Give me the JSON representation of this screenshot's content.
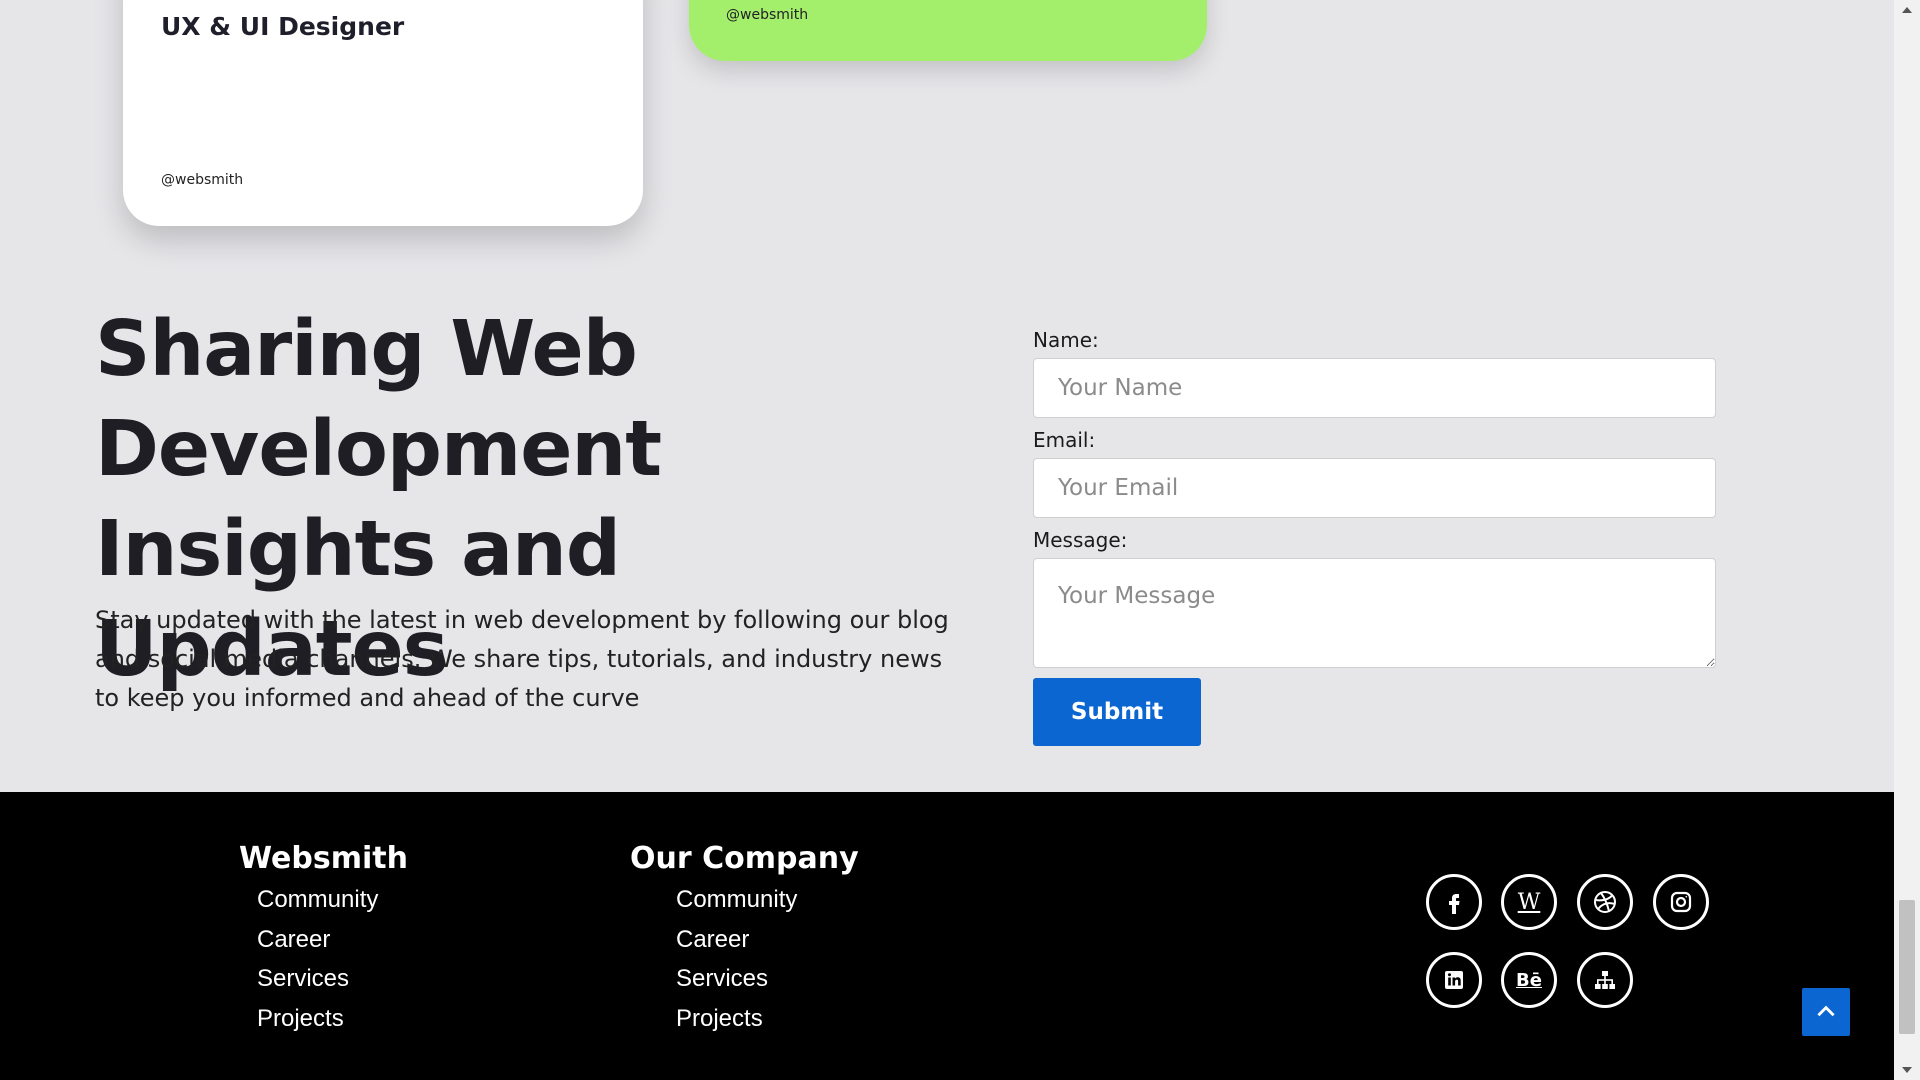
{
  "cards": {
    "designer": {
      "role": "UX & UI Designer",
      "handle": "@websmith"
    },
    "green": {
      "handle": "@websmith"
    }
  },
  "insights": {
    "title": "Sharing Web Development Insights and Updates",
    "text": "Stay updated with the latest in web development by following our blog and social media channels. We share tips, tutorials, and industry news to keep you informed and ahead of the curve"
  },
  "form": {
    "name_label": "Name:",
    "name_placeholder": "Your Name",
    "email_label": "Email:",
    "email_placeholder": "Your Email",
    "message_label": "Message:",
    "message_placeholder": "Your Message",
    "submit_label": "Submit"
  },
  "footer": {
    "col1": {
      "title": "Websmith",
      "links": [
        "Community",
        "Career",
        "Services",
        "Projects"
      ]
    },
    "col2": {
      "title": "Our Company",
      "links": [
        "Community",
        "Career",
        "Services",
        "Projects"
      ]
    },
    "social": [
      "facebook-icon",
      "wikipedia-icon",
      "dribbble-icon",
      "instagram-icon",
      "linkedin-icon",
      "behance-icon",
      "sitemap-icon"
    ],
    "social_text": {
      "wikipedia": "W",
      "behance": "Bē"
    }
  },
  "colors": {
    "accent_blue": "#0c66d1",
    "green_card": "#a3ef6c",
    "background": "#e6e6e9",
    "footer_bg": "#000000"
  }
}
